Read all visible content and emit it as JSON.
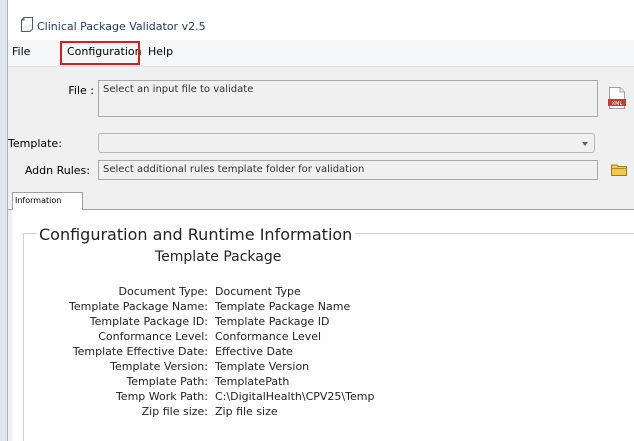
{
  "window": {
    "title": "Clinical Package Validator v2.5"
  },
  "menu": {
    "items": [
      "File",
      "Configuration",
      "Help"
    ]
  },
  "form": {
    "file_label": "File :",
    "file_placeholder": "Select an input file to validate",
    "template_label": "Template:",
    "template_value": "",
    "addn_label": "Addn Rules:",
    "addn_placeholder": "Select additional rules template folder for validation"
  },
  "tabs": [
    "Information"
  ],
  "info": {
    "group_title": "Configuration and Runtime Information",
    "subtitle": "Template Package",
    "rows": [
      {
        "key": "Document Type:",
        "value": "Document Type"
      },
      {
        "key": "Template Package Name:",
        "value": "Template Package Name"
      },
      {
        "key": "Template Package ID:",
        "value": "Template Package ID"
      },
      {
        "key": "Conformance Level:",
        "value": "Conformance Level"
      },
      {
        "key": "Template Effective Date:",
        "value": "Effective Date"
      },
      {
        "key": "Template Version:",
        "value": "Template Version"
      },
      {
        "key": "Template Path:",
        "value": "TemplatePath"
      },
      {
        "key": "Temp Work Path:",
        "value": "C:\\DigitalHealth\\CPV25\\Temp"
      },
      {
        "key": "Zip file size:",
        "value": "Zip file size"
      }
    ]
  },
  "icons": {
    "app": "document-icon",
    "file_picker": "xml-file-icon",
    "folder_picker": "folder-icon"
  },
  "colors": {
    "highlight": "#e01b1b",
    "title_text": "#1e395b"
  }
}
